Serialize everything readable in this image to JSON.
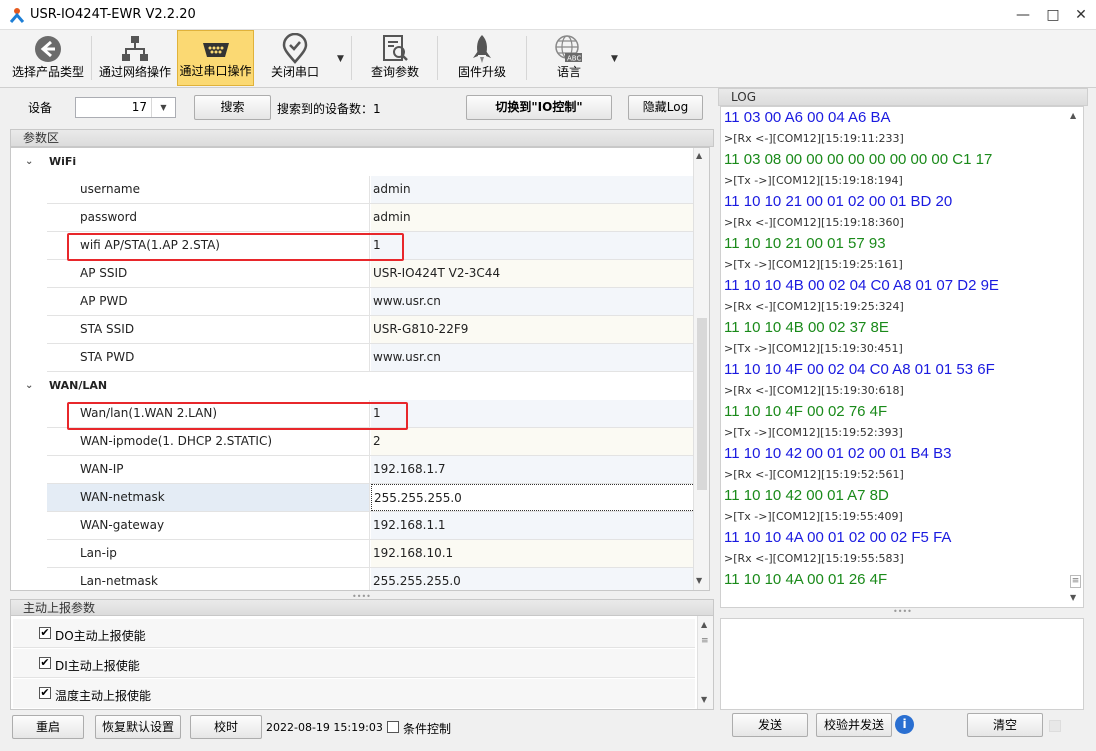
{
  "window": {
    "title": "USR-IO424T-EWR V2.2.20"
  },
  "toolbar": {
    "items": [
      {
        "label": "选择产品类型",
        "icon": "back-arrow-icon"
      },
      {
        "label": "通过网络操作",
        "icon": "network-icon"
      },
      {
        "label": "通过串口操作",
        "icon": "serial-port-icon"
      },
      {
        "label": "关闭串口",
        "icon": "location-check-icon"
      },
      {
        "label": "查询参数",
        "icon": "query-doc-icon"
      },
      {
        "label": "固件升级",
        "icon": "rocket-icon"
      },
      {
        "label": "语言",
        "icon": "globe-abc-icon"
      }
    ]
  },
  "device": {
    "label": "设备",
    "value": "17",
    "search_label": "搜索",
    "found_label": "搜索到的设备数：1",
    "switch_label": "切换到\"IO控制\"",
    "hide_log_label": "隐藏Log"
  },
  "params": {
    "section_title": "参数区",
    "groups": [
      {
        "title": "WiFi",
        "rows": [
          {
            "name": "username",
            "value": "admin"
          },
          {
            "name": "password",
            "value": "admin"
          },
          {
            "name": "wifi AP/STA(1.AP 2.STA)",
            "value": "1"
          },
          {
            "name": "AP SSID",
            "value": "USR-IO424T V2-3C44"
          },
          {
            "name": "AP PWD",
            "value": "www.usr.cn"
          },
          {
            "name": "STA SSID",
            "value": "USR-G810-22F9"
          },
          {
            "name": "STA PWD",
            "value": "www.usr.cn"
          }
        ]
      },
      {
        "title": "WAN/LAN",
        "rows": [
          {
            "name": "Wan/lan(1.WAN 2.LAN)",
            "value": "1"
          },
          {
            "name": "WAN-ipmode(1. DHCP 2.STATIC)",
            "value": "2"
          },
          {
            "name": "WAN-IP",
            "value": "192.168.1.7"
          },
          {
            "name": "WAN-netmask",
            "value": "255.255.255.0"
          },
          {
            "name": "WAN-gateway",
            "value": "192.168.1.1"
          },
          {
            "name": "Lan-ip",
            "value": "192.168.10.1"
          },
          {
            "name": "Lan-netmask",
            "value": "255.255.255.0"
          }
        ]
      }
    ]
  },
  "report": {
    "section_title": "主动上报参数",
    "items": [
      {
        "label": "DO主动上报使能",
        "checked": "✔"
      },
      {
        "label": "DI主动上报使能",
        "checked": "✔"
      },
      {
        "label": "温度主动上报使能",
        "checked": "✔"
      }
    ]
  },
  "bottom": {
    "restart": "重启",
    "restore": "恢复默认设置",
    "sync_time": "校时",
    "datetime": "2022-08-19 15:19:03 5",
    "cond_control": "条件控制"
  },
  "log": {
    "title": "LOG",
    "lines": [
      {
        "text": "11 03 00 A6 00 04 A6 BA",
        "kind": "blue"
      },
      {
        "text": ">[Rx <-][COM12][15:19:11:233]",
        "kind": "meta"
      },
      {
        "text": "11 03 08 00 00 00 00 00 00 00 00 C1 17",
        "kind": "green"
      },
      {
        "text": ">[Tx ->][COM12][15:19:18:194]",
        "kind": "meta"
      },
      {
        "text": "11 10 10 21 00 01 02 00 01 BD 20",
        "kind": "blue"
      },
      {
        "text": ">[Rx <-][COM12][15:19:18:360]",
        "kind": "meta"
      },
      {
        "text": "11 10 10 21 00 01 57 93",
        "kind": "green"
      },
      {
        "text": ">[Tx ->][COM12][15:19:25:161]",
        "kind": "meta"
      },
      {
        "text": "11 10 10 4B 00 02 04 C0 A8 01 07 D2 9E",
        "kind": "blue"
      },
      {
        "text": ">[Rx <-][COM12][15:19:25:324]",
        "kind": "meta"
      },
      {
        "text": "11 10 10 4B 00 02 37 8E",
        "kind": "green"
      },
      {
        "text": ">[Tx ->][COM12][15:19:30:451]",
        "kind": "meta"
      },
      {
        "text": "11 10 10 4F 00 02 04 C0 A8 01 01 53 6F",
        "kind": "blue"
      },
      {
        "text": ">[Rx <-][COM12][15:19:30:618]",
        "kind": "meta"
      },
      {
        "text": "11 10 10 4F 00 02 76 4F",
        "kind": "green"
      },
      {
        "text": ">[Tx ->][COM12][15:19:52:393]",
        "kind": "meta"
      },
      {
        "text": "11 10 10 42 00 01 02 00 01 B4 B3",
        "kind": "blue"
      },
      {
        "text": ">[Rx <-][COM12][15:19:52:561]",
        "kind": "meta"
      },
      {
        "text": "11 10 10 42 00 01 A7 8D",
        "kind": "green"
      },
      {
        "text": ">[Tx ->][COM12][15:19:55:409]",
        "kind": "meta"
      },
      {
        "text": "11 10 10 4A 00 01 02 00 02 F5 FA",
        "kind": "blue"
      },
      {
        "text": ">[Rx <-][COM12][15:19:55:583]",
        "kind": "meta"
      },
      {
        "text": "11 10 10 4A 00 01 26 4F",
        "kind": "green"
      }
    ],
    "send": "发送",
    "verify_send": "校验并发送",
    "clear": "清空"
  },
  "colors": {
    "accent": "#fbd973",
    "highlight": "#e8272b",
    "rx_blue": "#1a1ae0",
    "tx_green": "#1a8a1a"
  }
}
